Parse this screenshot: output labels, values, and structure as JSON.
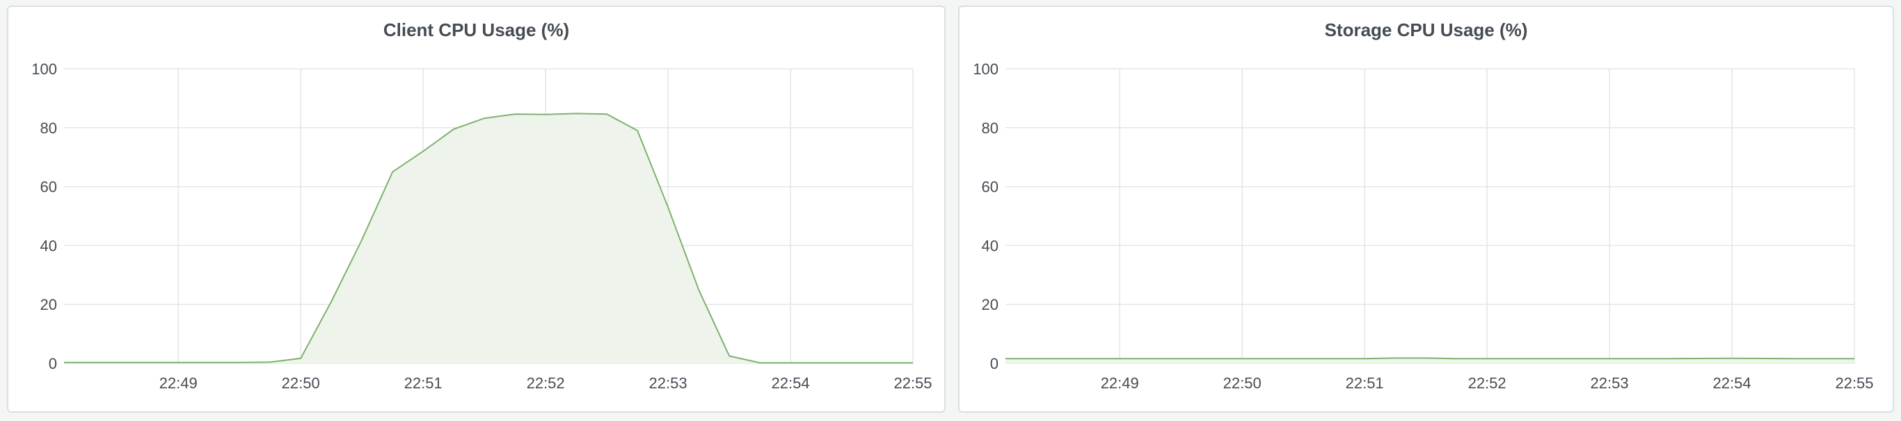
{
  "panels": [
    {
      "title": "Client CPU Usage (%)"
    },
    {
      "title": "Storage CPU Usage (%)"
    }
  ],
  "chart_data": [
    {
      "type": "area",
      "title": "Client CPU Usage (%)",
      "xlabel": "",
      "ylabel": "",
      "ylim": [
        0,
        100
      ],
      "yticks": [
        0,
        20,
        40,
        60,
        80,
        100
      ],
      "xticks": [
        "22:49",
        "22:50",
        "22:51",
        "22:52",
        "22:53",
        "22:54",
        "22:55"
      ],
      "xlim": [
        "22:48:04",
        "22:55:00"
      ],
      "grid": true,
      "color": "#7eb26d",
      "fill": "#eef4ec",
      "series": [
        {
          "x": [
            "22:48:04",
            "22:48:30",
            "22:49:00",
            "22:49:30",
            "22:49:45",
            "22:50:00",
            "22:50:15",
            "22:50:30",
            "22:50:45",
            "22:51:00",
            "22:51:15",
            "22:51:30",
            "22:51:45",
            "22:52:00",
            "22:52:15",
            "22:52:30",
            "22:52:45",
            "22:53:00",
            "22:53:15",
            "22:53:30",
            "22:53:45",
            "22:54:00",
            "22:54:30",
            "22:55:00"
          ],
          "values": [
            0.3,
            0.3,
            0.3,
            0.3,
            0.4,
            1.7,
            21,
            42,
            65,
            72,
            79.5,
            83.2,
            84.6,
            84.5,
            84.8,
            84.6,
            79,
            53,
            25,
            2.5,
            0.2,
            0.2,
            0.2,
            0.2
          ]
        }
      ]
    },
    {
      "type": "area",
      "title": "Storage CPU Usage (%)",
      "xlabel": "",
      "ylabel": "",
      "ylim": [
        0,
        100
      ],
      "yticks": [
        0,
        20,
        40,
        60,
        80,
        100
      ],
      "xticks": [
        "22:49",
        "22:50",
        "22:51",
        "22:52",
        "22:53",
        "22:54",
        "22:55"
      ],
      "xlim": [
        "22:48:04",
        "22:55:00"
      ],
      "grid": true,
      "color": "#7eb26d",
      "fill": "#eef4ec",
      "series": [
        {
          "x": [
            "22:48:04",
            "22:48:30",
            "22:49:00",
            "22:49:30",
            "22:50:00",
            "22:50:30",
            "22:51:00",
            "22:51:15",
            "22:51:30",
            "22:51:45",
            "22:52:00",
            "22:52:30",
            "22:53:00",
            "22:53:30",
            "22:54:00",
            "22:54:30",
            "22:55:00"
          ],
          "values": [
            1.6,
            1.6,
            1.6,
            1.6,
            1.6,
            1.6,
            1.6,
            1.8,
            1.8,
            1.6,
            1.6,
            1.6,
            1.6,
            1.6,
            1.7,
            1.6,
            1.6
          ]
        }
      ]
    }
  ]
}
